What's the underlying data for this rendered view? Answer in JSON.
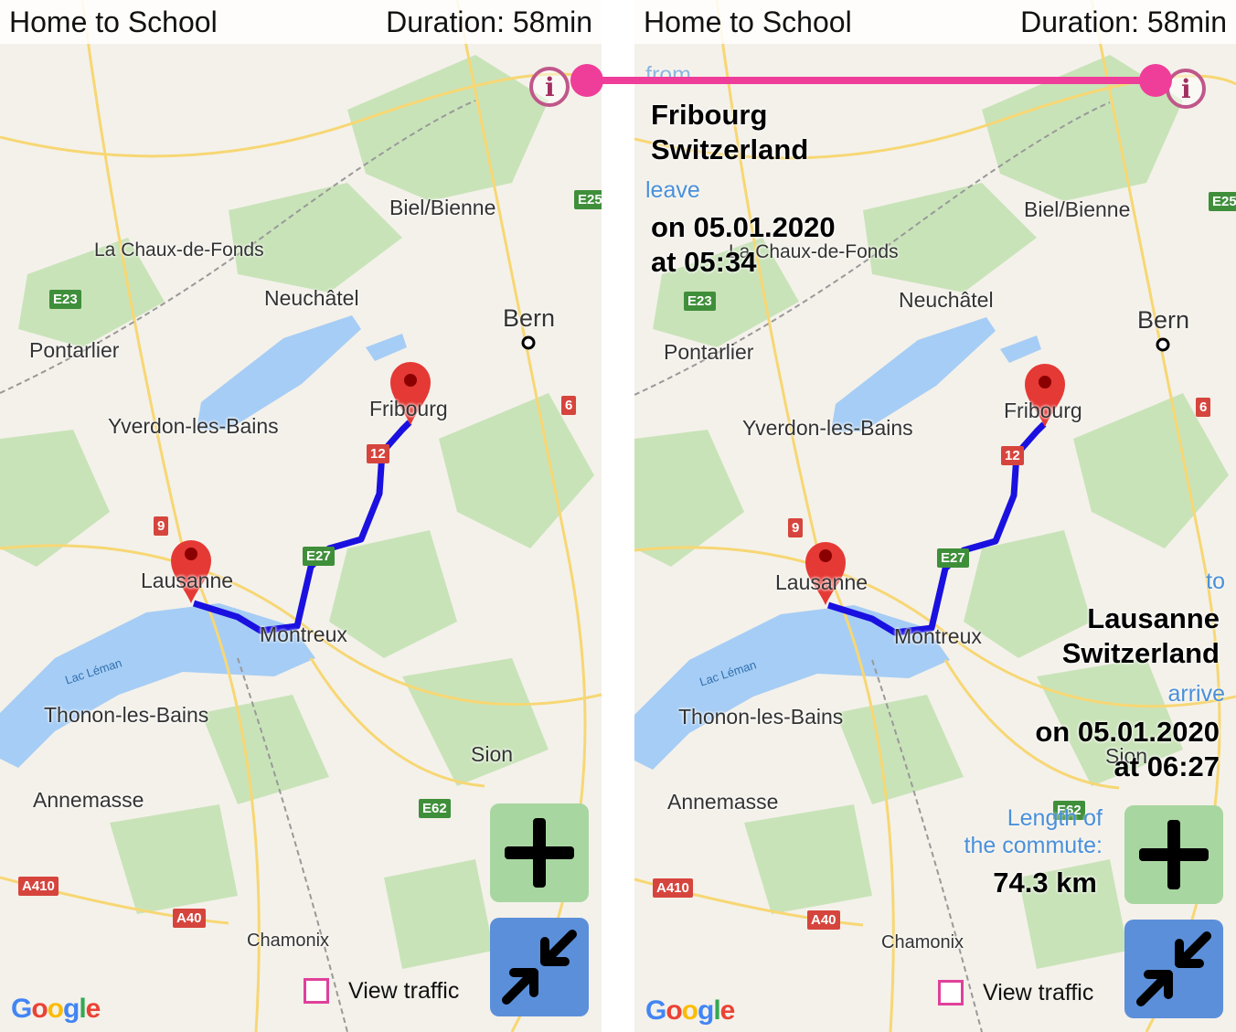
{
  "app": {
    "title": "Home to School",
    "duration": "Duration: 58min",
    "view_traffic_label": "View traffic",
    "google_logo": "Google",
    "info_icon": "info-icon",
    "zoom_icon": "plus-icon",
    "collapse_icon": "collapse-arrows-icon"
  },
  "map_labels": {
    "biel": "Biel/Bienne",
    "chaux": "La Chaux-de-Fonds",
    "neuchatel": "Neuchâtel",
    "bern": "Bern",
    "pontarlier": "Pontarlier",
    "fribourg": "Fribourg",
    "yverdon": "Yverdon-les-Bains",
    "lausanne": "Lausanne",
    "montreux": "Montreux",
    "lac_leman": "Lac Léman",
    "thonon": "Thonon-les-Bains",
    "sion": "Sion",
    "annemasse": "Annemasse",
    "chamonix": "Chamonix"
  },
  "road_shields": {
    "e25": "E25",
    "e23": "E23",
    "r6": "6",
    "r12": "12",
    "r9": "9",
    "e27": "E27",
    "e62": "E62",
    "a410": "A410",
    "a40": "A40"
  },
  "trip": {
    "from_label": "from",
    "from_place": "Fribourg",
    "from_country": "Switzerland",
    "leave_label": "leave",
    "leave_date": "on 05.01.2020",
    "leave_time": "at 05:34",
    "to_label": "to",
    "to_place": "Lausanne",
    "to_country": "Switzerland",
    "arrive_label": "arrive",
    "arrive_date": "on 05.01.2020",
    "arrive_time": "at 06:27",
    "length_label_1": "Length of",
    "length_label_2": "the commute:",
    "length_value": "74.3 km"
  },
  "colors": {
    "route": "#1a10e0",
    "connector": "#ef3d9a",
    "marker": "#e53935",
    "lake": "#a6cdf5",
    "forest": "#c7e2b8"
  }
}
